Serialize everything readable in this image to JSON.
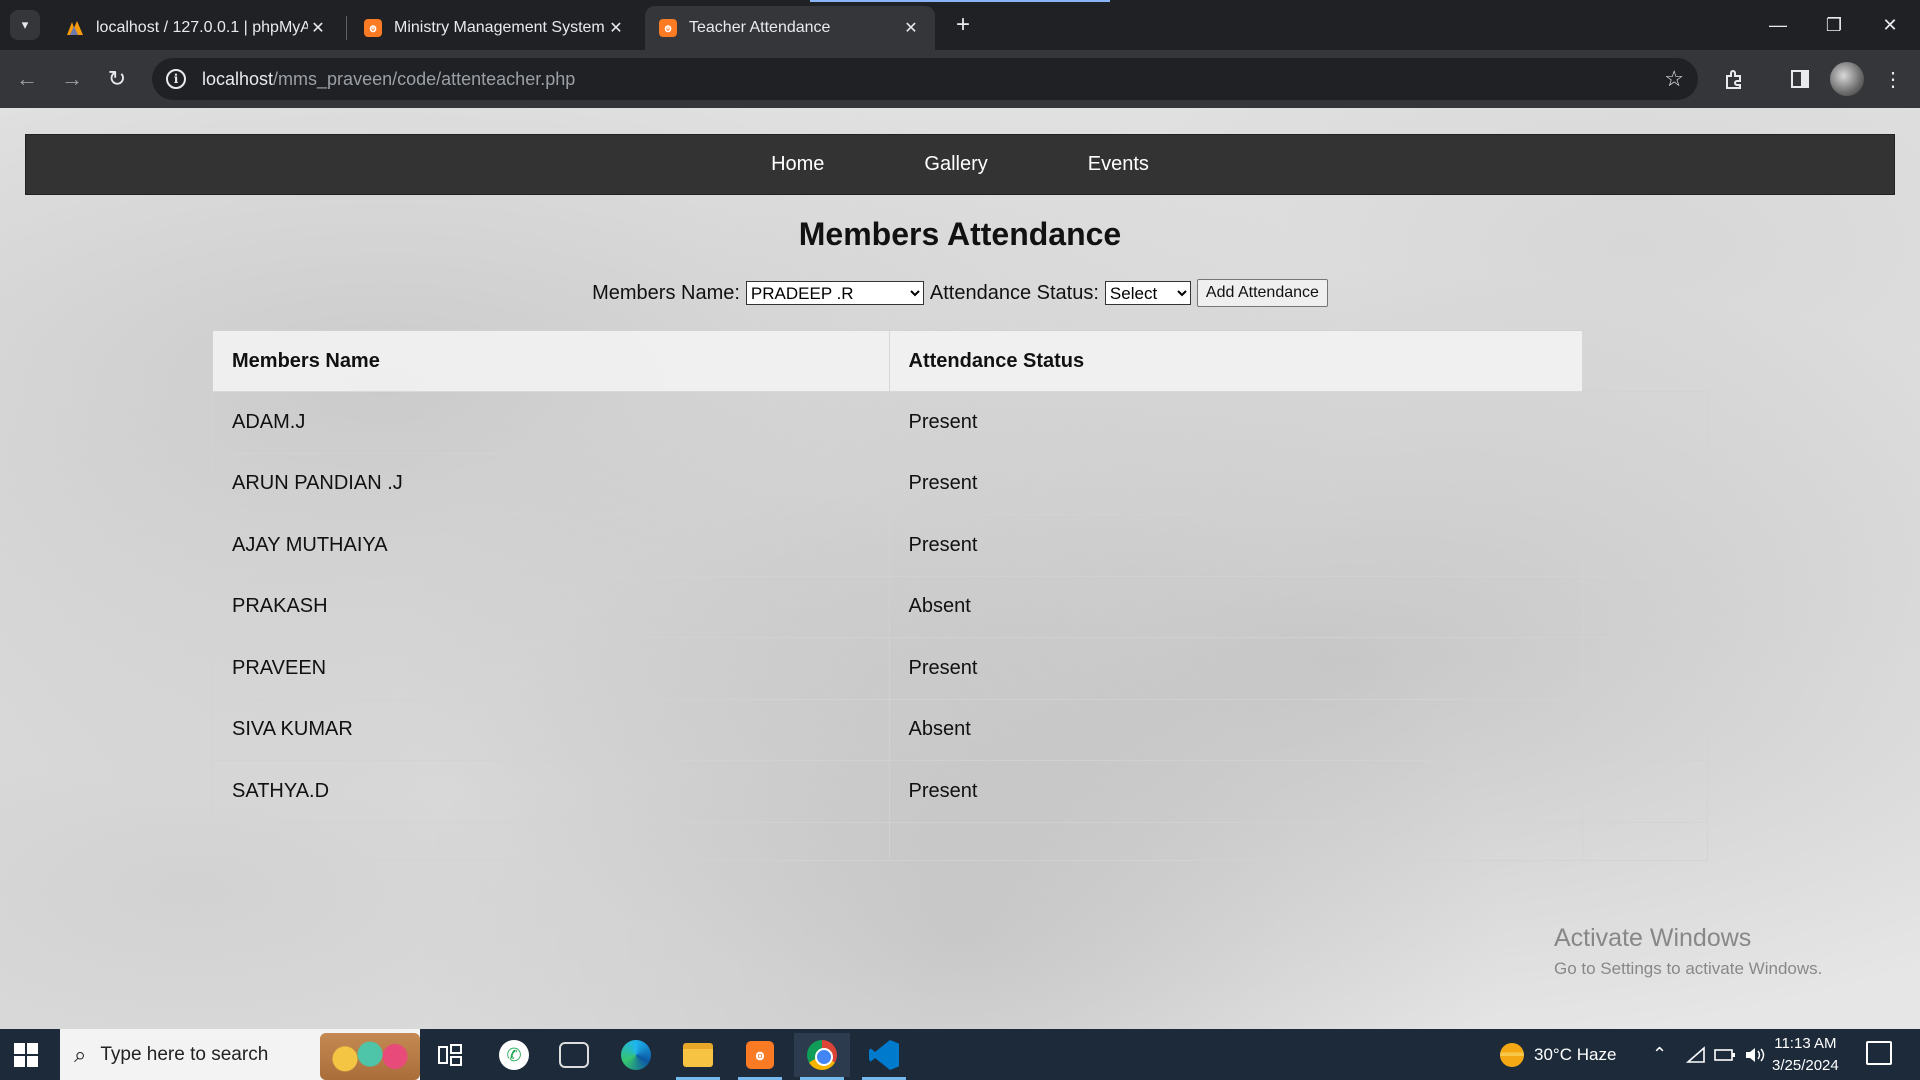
{
  "browser": {
    "tabs": [
      {
        "title": "localhost / 127.0.0.1 | phpMyAd",
        "icon": "phpmyadmin-icon"
      },
      {
        "title": "Ministry Management System",
        "icon": "xampp-icon"
      },
      {
        "title": "Teacher Attendance",
        "icon": "xampp-icon",
        "active": true
      }
    ],
    "close_glyph": "✕",
    "new_tab_glyph": "+",
    "url_host": "localhost",
    "url_path": "/mms_praveen/code/attenteacher.php"
  },
  "nav": {
    "home": "Home",
    "gallery": "Gallery",
    "events": "Events"
  },
  "page": {
    "title": "Members Attendance",
    "form": {
      "member_label": "Members Name:",
      "member_selected": "PRADEEP .R",
      "status_label": "Attendance Status:",
      "status_selected": "Select",
      "submit_label": "Add Attendance"
    },
    "table": {
      "headers": [
        "Members Name",
        "Attendance Status"
      ],
      "rows": [
        {
          "name": "ADAM.J",
          "status": "Present"
        },
        {
          "name": "ARUN PANDIAN .J",
          "status": "Present"
        },
        {
          "name": "AJAY MUTHAIYA",
          "status": "Present"
        },
        {
          "name": "PRAKASH",
          "status": "Absent"
        },
        {
          "name": "PRAVEEN",
          "status": "Present"
        },
        {
          "name": "SIVA KUMAR",
          "status": "Absent"
        },
        {
          "name": "SATHYA.D",
          "status": "Present"
        }
      ]
    }
  },
  "watermark": {
    "line1": "Activate Windows",
    "line2": "Go to Settings to activate Windows."
  },
  "taskbar": {
    "search_placeholder": "Type here to search",
    "weather": "30°C  Haze",
    "time": "11:13 AM",
    "date": "3/25/2024"
  }
}
